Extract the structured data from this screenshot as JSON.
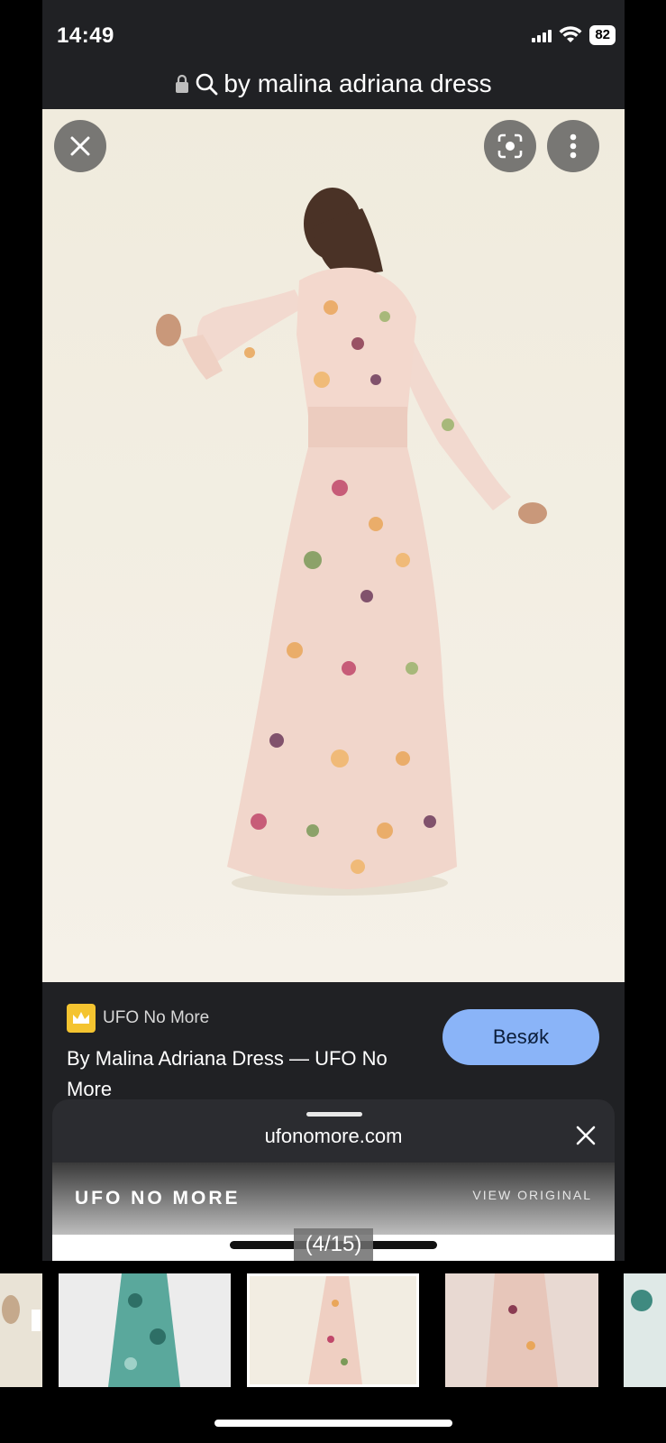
{
  "status_bar": {
    "time": "14:49",
    "battery": "82"
  },
  "url_bar": {
    "query": "by malina adriana dress"
  },
  "result": {
    "source_name": "UFO No More",
    "title": "By Malina Adriana Dress — UFO No More",
    "visit_label": "Besøk"
  },
  "sheet": {
    "domain": "ufonomore.com",
    "brand": "UFO NO MORE",
    "view_original": "VIEW ORIGINAL"
  },
  "counter": "(4/15)",
  "icons": {
    "close": "close-icon",
    "lens": "lens-icon",
    "more": "more-vert-icon",
    "lock": "lock-icon",
    "search": "search-icon"
  },
  "colors": {
    "visit_button": "#8ab4f8",
    "background": "#202124"
  }
}
